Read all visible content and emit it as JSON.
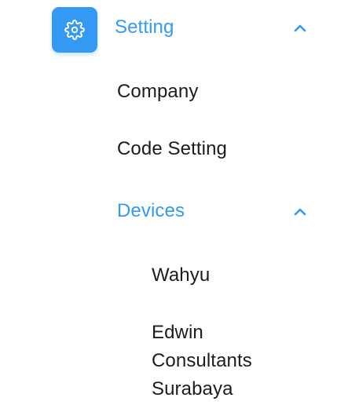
{
  "menu": {
    "setting": {
      "label": "Setting",
      "icon": "gear-icon",
      "expanded": true,
      "children": [
        {
          "label": "Company"
        },
        {
          "label": "Code Setting"
        }
      ]
    },
    "devices": {
      "label": "Devices",
      "expanded": true,
      "children": [
        {
          "label": "Wahyu"
        },
        {
          "lines": [
            "Edwin",
            "Consultants",
            "Surabaya"
          ]
        }
      ]
    }
  },
  "colors": {
    "accent": "#3399f3",
    "text": "#1c1c1c",
    "background": "#ffffff"
  }
}
